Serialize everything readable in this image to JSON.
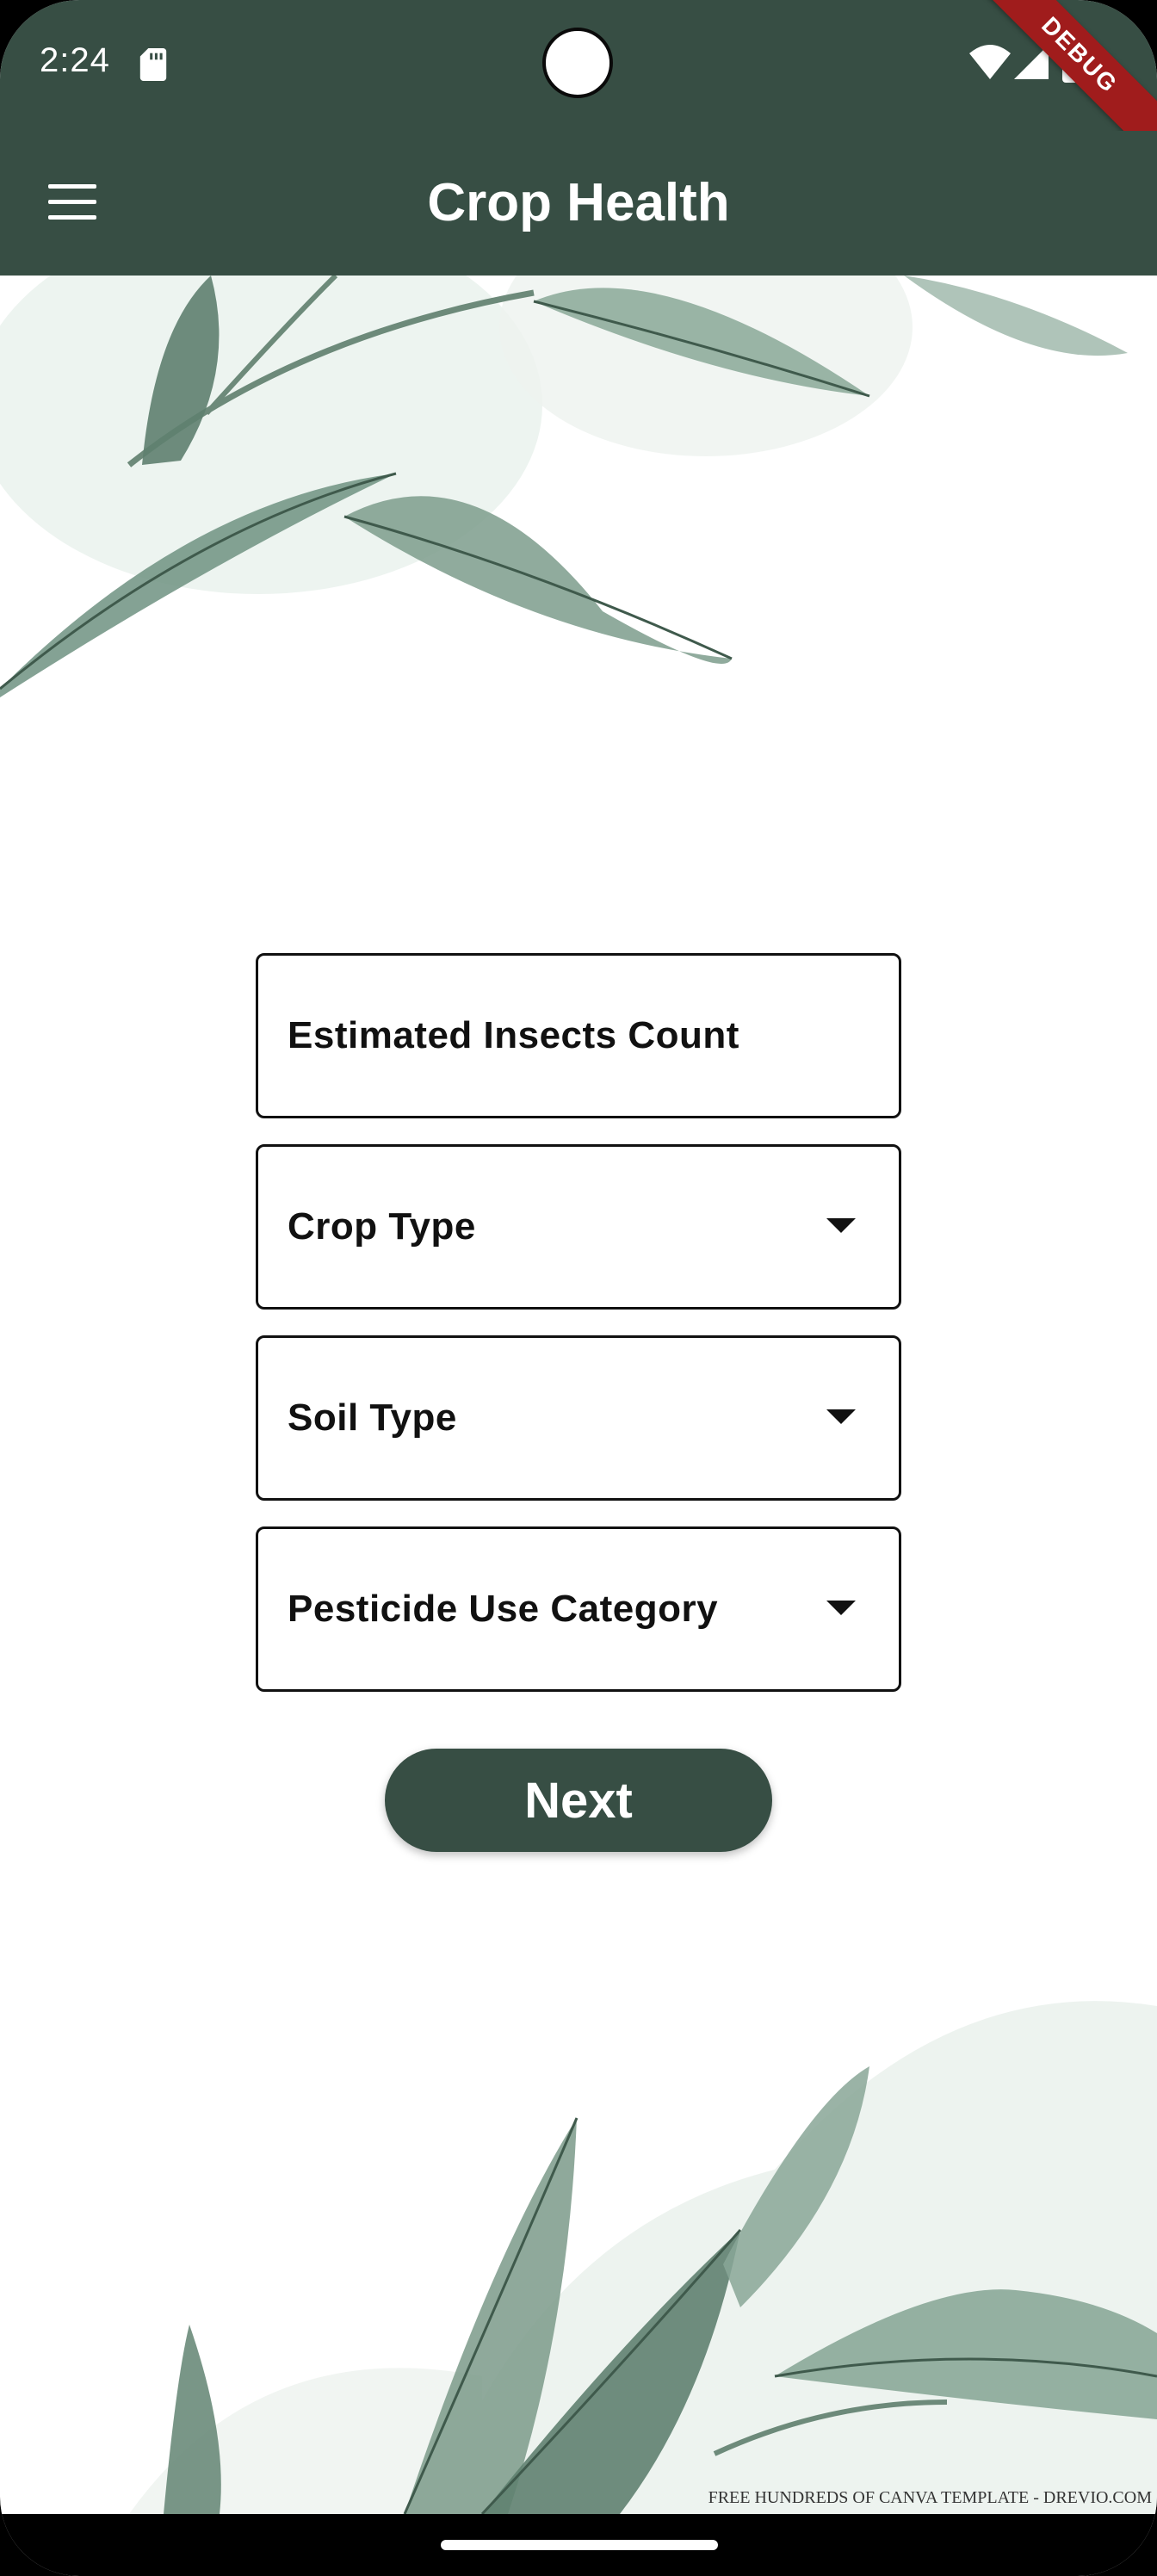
{
  "status_bar": {
    "time": "2:24",
    "icons": [
      "sd-card-icon",
      "wifi-icon",
      "cellular-signal-icon",
      "battery-icon"
    ]
  },
  "debug_banner": "DEBUG",
  "app_bar": {
    "menu_icon": "hamburger-menu-icon",
    "title": "Crop Health"
  },
  "form": {
    "insects_count": {
      "label": "Estimated Insects Count"
    },
    "crop_type": {
      "label": "Crop Type",
      "icon": "dropdown-arrow-icon"
    },
    "soil_type": {
      "label": "Soil Type",
      "icon": "dropdown-arrow-icon"
    },
    "pesticide_category": {
      "label": "Pesticide Use Category",
      "icon": "dropdown-arrow-icon"
    }
  },
  "next_button": {
    "label": "Next"
  },
  "watermark": "FREE HUNDREDS OF CANVA TEMPLATE - DREVIO.COM",
  "colors": {
    "primary": "#374e44",
    "on_primary": "#ffffff",
    "text": "#111111",
    "leaf": "#4f6b5c",
    "debug": "#a01c1c"
  }
}
